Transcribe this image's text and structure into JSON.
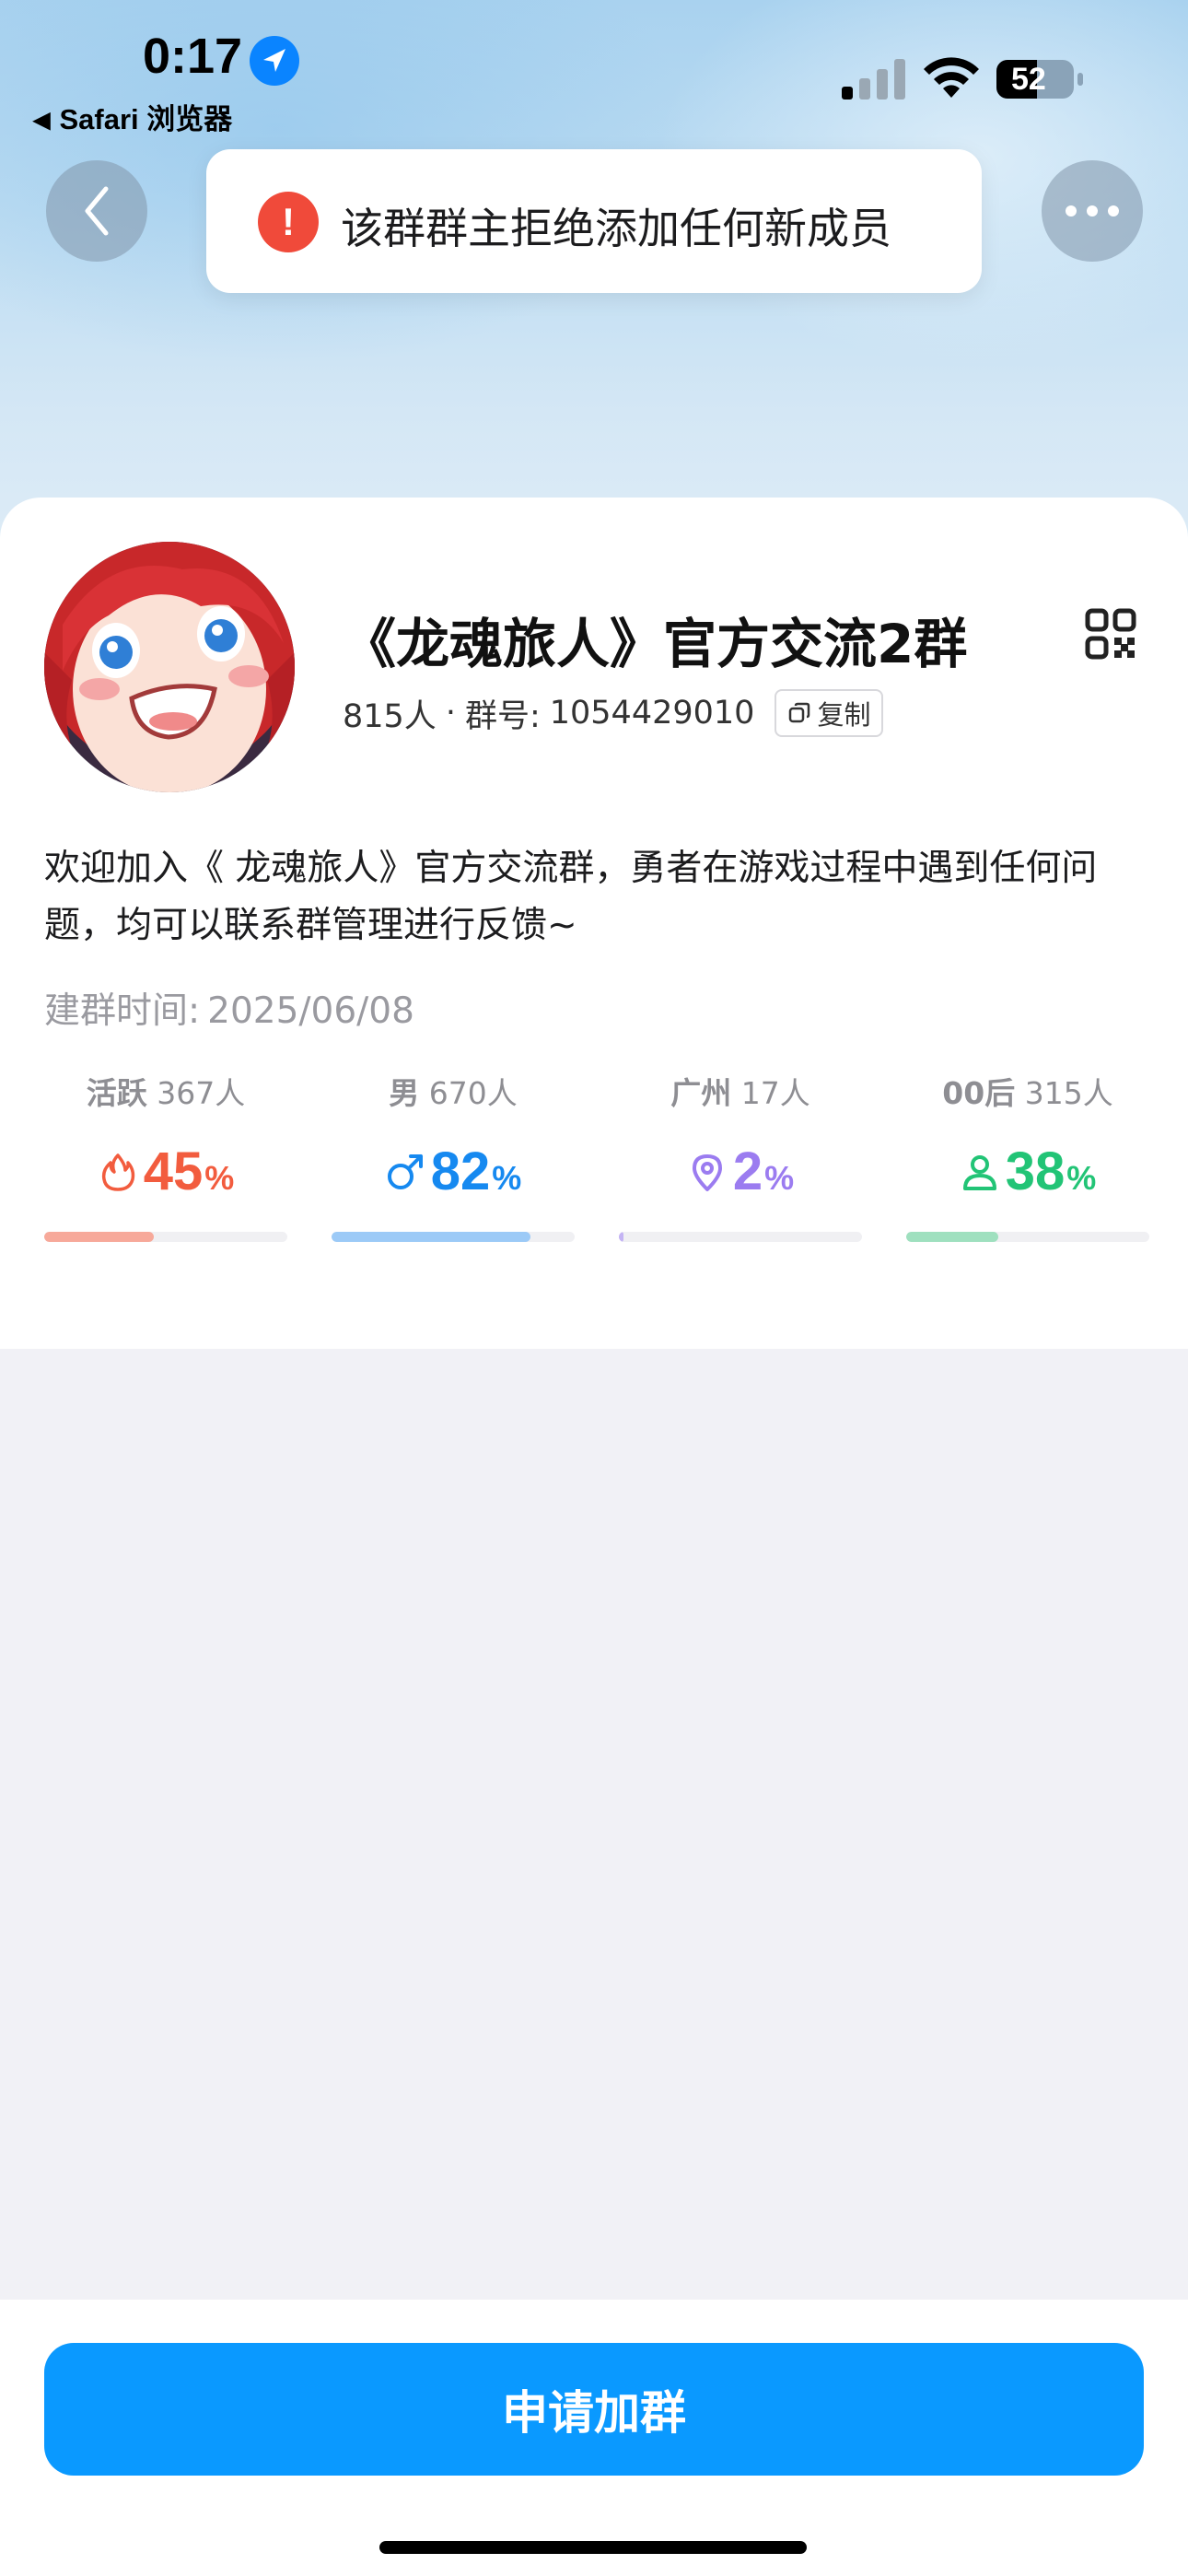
{
  "status_bar": {
    "time": "0:17",
    "back_app": "Safari 浏览器",
    "battery": "52"
  },
  "toast": {
    "message": "该群群主拒绝添加任何新成员",
    "icon": "alert-icon",
    "color": "#f04a3a"
  },
  "group": {
    "name": "《龙魂旅人》官方交流2群",
    "members": "815人",
    "separator": "·",
    "id_label": "群号:",
    "id": "1054429010",
    "copy_label": "复制",
    "description": "欢迎加入《 龙魂旅人》官方交流群，勇者在游戏过程中遇到任何问题，均可以联系群管理进行反馈~",
    "created_label": "建群时间:",
    "created_date": "2025/06/08"
  },
  "stats": [
    {
      "key": "活跃",
      "count": "367人",
      "value": "45",
      "unit": "%",
      "fraction": 0.45,
      "color": "#f25c3e",
      "bar_color": "#f7a99a",
      "icon": "flame-icon"
    },
    {
      "key": "男",
      "count": "670人",
      "value": "82",
      "unit": "%",
      "fraction": 0.82,
      "color": "#1689f0",
      "bar_color": "#9ccaf7",
      "icon": "male-icon"
    },
    {
      "key": "广州",
      "count": "17人",
      "value": "2",
      "unit": "%",
      "fraction": 0.02,
      "color": "#9b7cf0",
      "bar_color": "#c4b4f4",
      "icon": "location-pin-icon"
    },
    {
      "key": "00后",
      "count": "315人",
      "value": "38",
      "unit": "%",
      "fraction": 0.38,
      "color": "#22c476",
      "bar_color": "#9fe0bf",
      "icon": "person-icon"
    }
  ],
  "actions": {
    "join_label": "申请加群",
    "join_color": "#0a99ff"
  }
}
